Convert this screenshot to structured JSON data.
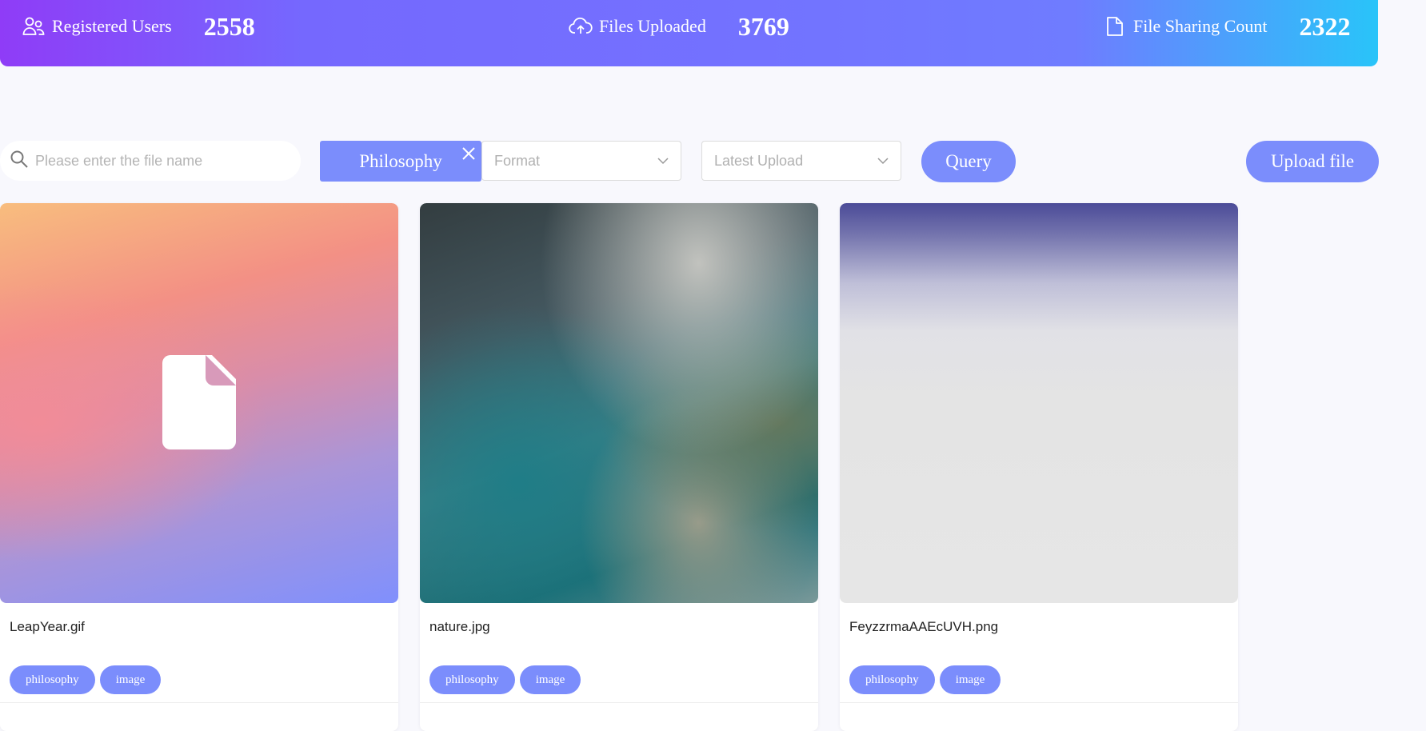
{
  "stats": {
    "registered_users": {
      "label": "Registered Users",
      "value": "2558",
      "icon": "users-icon"
    },
    "files_uploaded": {
      "label": "Files Uploaded",
      "value": "3769",
      "icon": "cloud-upload-icon"
    },
    "file_sharing": {
      "label": "File Sharing Count",
      "value": "2322",
      "icon": "document-icon"
    }
  },
  "toolbar": {
    "search_placeholder": "Please enter the file name",
    "search_value": "",
    "tag_filter": "Philosophy",
    "format_placeholder": "Format",
    "sort_placeholder": "Latest Upload",
    "query_label": "Query",
    "upload_label": "Upload file"
  },
  "files": [
    {
      "name": "LeapYear.gif",
      "tags": [
        "philosophy",
        "image"
      ],
      "thumbnail": "file-placeholder-icon"
    },
    {
      "name": "nature.jpg",
      "tags": [
        "philosophy",
        "image"
      ],
      "thumbnail": "blurred-image"
    },
    {
      "name": "FeyzzrmaAAEcUVH.png",
      "tags": [
        "philosophy",
        "image"
      ],
      "thumbnail": "blurred-image"
    }
  ],
  "colors": {
    "accent": "#7b8dfc",
    "banner_start": "#8f3cf7",
    "banner_end": "#29c4f9",
    "page_background": "#f8f8fd"
  }
}
